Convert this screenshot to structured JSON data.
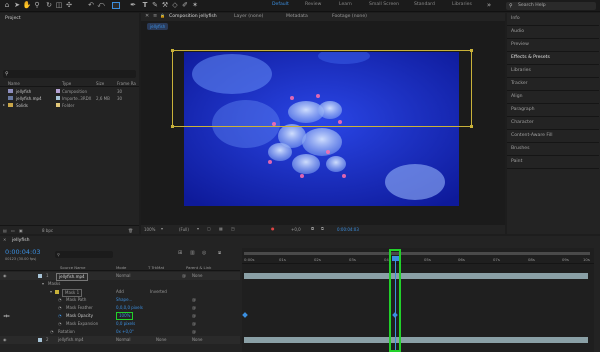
{
  "toolbar": {
    "workspaces": [
      {
        "label": "Default",
        "active": true
      },
      {
        "label": "Review",
        "active": false
      },
      {
        "label": "Learn",
        "active": false
      },
      {
        "label": "Small Screen",
        "active": false
      },
      {
        "label": "Standard",
        "active": false
      },
      {
        "label": "Libraries",
        "active": false
      }
    ],
    "search_placeholder": "Search Help"
  },
  "project": {
    "title": "Project",
    "search_icon": "search-icon",
    "columns": [
      "Name",
      "Type",
      "Size",
      "Frame Ra"
    ],
    "items": [
      {
        "name": "jellyfish",
        "type": "Composition",
        "size": "",
        "fps": "30"
      },
      {
        "name": "jellyfish.mp4",
        "type": "Importe..3RDX",
        "size": "2,6 MB",
        "fps": "30"
      },
      {
        "name": "Solids",
        "type": "Folder",
        "size": "",
        "fps": ""
      }
    ],
    "footer": "8 bpc"
  },
  "viewer": {
    "tabs": [
      {
        "label": "Composition jellyfish",
        "active": true
      },
      {
        "label": "Layer (none)",
        "active": false
      },
      {
        "label": "Metadata",
        "active": false
      },
      {
        "label": "Footage (none)",
        "active": false
      }
    ],
    "comp_chip": "jellyfish",
    "zoom": "100%",
    "resolution": "(Full)",
    "offset": "+0,0",
    "timecode": "0:00:04:03"
  },
  "right_panel": {
    "items": [
      "Info",
      "Audio",
      "Preview",
      "Effects & Presets",
      "Libraries",
      "Tracker",
      "Align",
      "Paragraph",
      "Character",
      "Content-Aware Fill",
      "Brushes",
      "Paint"
    ],
    "active": "Effects & Presets"
  },
  "timeline": {
    "tab": "jellyfish",
    "timecode": "0:00:04:03",
    "timecode_sub": "00123 (30.00 fps)",
    "headers": {
      "source": "Source Name",
      "mode": "Mode",
      "trkmat": "T TrkMat",
      "parent": "Parent & Link"
    },
    "ruler": [
      "0:00s",
      "01s",
      "02s",
      "03s",
      "04s",
      "05s",
      "06s",
      "07s",
      "08s",
      "09s",
      "10s"
    ],
    "rows": [
      {
        "num": "1",
        "name": "jellyfish.mp4",
        "mode": "Normal",
        "parent": "None"
      },
      {
        "label": "Masks"
      },
      {
        "label": "Mask 1",
        "mode": "Add",
        "extra": "Inverted"
      },
      {
        "label": "Mask Path",
        "value": "Shape..."
      },
      {
        "label": "Mask Feather",
        "value": "0,0,0,0 pixels"
      },
      {
        "label": "Mask Opacity",
        "value": "100%"
      },
      {
        "label": "Mask Expansion",
        "value": "0,0 pixels"
      },
      {
        "label": "Rotation",
        "value": "0x +0,0°"
      },
      {
        "num": "2",
        "name": "jellyfish.mp4",
        "mode": "Normal",
        "trkmat": "None",
        "parent": "None"
      }
    ]
  },
  "colors": {
    "accent": "#3b8fe0",
    "highlight": "#22d02a",
    "mask": "#c9b23a",
    "footage": "#1a2bd0"
  }
}
